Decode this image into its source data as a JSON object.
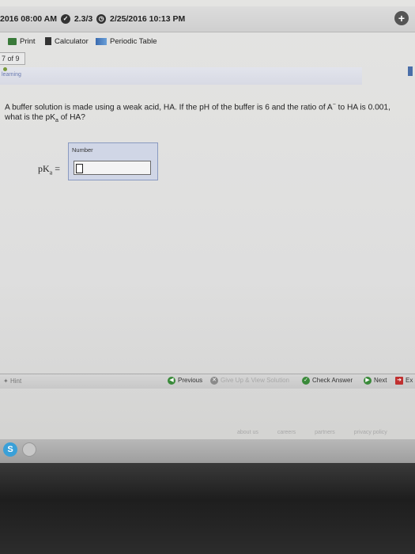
{
  "topbar": {
    "start_time": "2016 08:00 AM",
    "score": "2.3/3",
    "due_time": "2/25/2016 10:13 PM"
  },
  "toolbar": {
    "print": "Print",
    "calculator": "Calculator",
    "periodic_table": "Periodic Table"
  },
  "question_counter": "7 of 9",
  "banner": {
    "logo": "learning"
  },
  "question": {
    "text_part1": "A buffer solution is made using a weak acid, HA. If the pH of the buffer is 6 and the ratio of A",
    "superscript": "−",
    "text_part2": " to HA is 0.001, what is the pK",
    "subscript": "a",
    "text_part3": " of HA?"
  },
  "answer": {
    "box_label": "Number",
    "pk_label": "pK",
    "pk_sub": "a",
    "equals": " =",
    "value": ""
  },
  "bottom": {
    "hint": "Hint",
    "previous": "Previous",
    "give_up": "Give Up & View Solution",
    "check_answer": "Check Answer",
    "next": "Next",
    "exit": "Ex"
  },
  "footer": {
    "about": "about us",
    "careers": "careers",
    "partners": "partners",
    "privacy": "privacy policy"
  },
  "colors": {
    "accent": "#4a6ea8",
    "check_green": "#3a8a3a",
    "give_up_red": "#888888"
  }
}
